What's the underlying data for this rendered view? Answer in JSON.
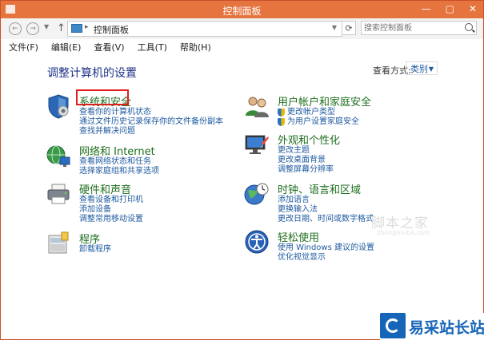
{
  "window": {
    "title": "控制面板",
    "buttons": [
      "—",
      "▢",
      "✕"
    ]
  },
  "address": {
    "path": "控制面板",
    "separator": "▸"
  },
  "search": {
    "placeholder": "搜索控制面板"
  },
  "menu": [
    "文件(F)",
    "编辑(E)",
    "查看(V)",
    "工具(T)",
    "帮助(H)"
  ],
  "main": {
    "title": "调整计算机的设置",
    "view_by_label": "查看方式:",
    "view_by_value": "类别"
  },
  "categories": [
    {
      "title": "系统和安全",
      "icon": "shield-icon",
      "links": [
        {
          "text": "查看你的计算机状态"
        },
        {
          "text": "通过文件历史记录保存你的文件备份副本"
        },
        {
          "text": "查找并解决问题"
        }
      ]
    },
    {
      "title": "网络和 Internet",
      "icon": "network-globe-icon",
      "links": [
        {
          "text": "查看网络状态和任务"
        },
        {
          "text": "选择家庭组和共享选项"
        }
      ]
    },
    {
      "title": "硬件和声音",
      "icon": "printer-icon",
      "links": [
        {
          "text": "查看设备和打印机"
        },
        {
          "text": "添加设备"
        },
        {
          "text": "调整常用移动设置"
        }
      ]
    },
    {
      "title": "程序",
      "icon": "programs-icon",
      "links": [
        {
          "text": "卸载程序"
        }
      ]
    },
    {
      "title": "用户帐户和家庭安全",
      "icon": "users-icon",
      "links": [
        {
          "text": "更改帐户类型",
          "shield": true
        },
        {
          "text": "为用户设置家庭安全",
          "shield": true
        }
      ]
    },
    {
      "title": "外观和个性化",
      "icon": "monitor-icon",
      "links": [
        {
          "text": "更改主题"
        },
        {
          "text": "更改桌面背景"
        },
        {
          "text": "调整屏幕分辨率"
        }
      ]
    },
    {
      "title": "时钟、语言和区域",
      "icon": "clock-globe-icon",
      "links": [
        {
          "text": "添加语言"
        },
        {
          "text": "更换输入法"
        },
        {
          "text": "更改日期、时间或数字格式"
        }
      ]
    },
    {
      "title": "轻松使用",
      "icon": "accessibility-icon",
      "links": [
        {
          "text": "使用 Windows 建议的设置"
        },
        {
          "text": "优化视觉显示"
        }
      ]
    }
  ],
  "watermark": {
    "text": "脚本之家",
    "sub": "zhongmuba.com"
  },
  "logo": {
    "text": "易采站长站",
    "icon": "yicai-logo-icon"
  },
  "colors": {
    "titlebar": "#e6743e",
    "link": "#1e5aa0",
    "category_title": "#1e6e1e",
    "highlight": "#e02020"
  }
}
